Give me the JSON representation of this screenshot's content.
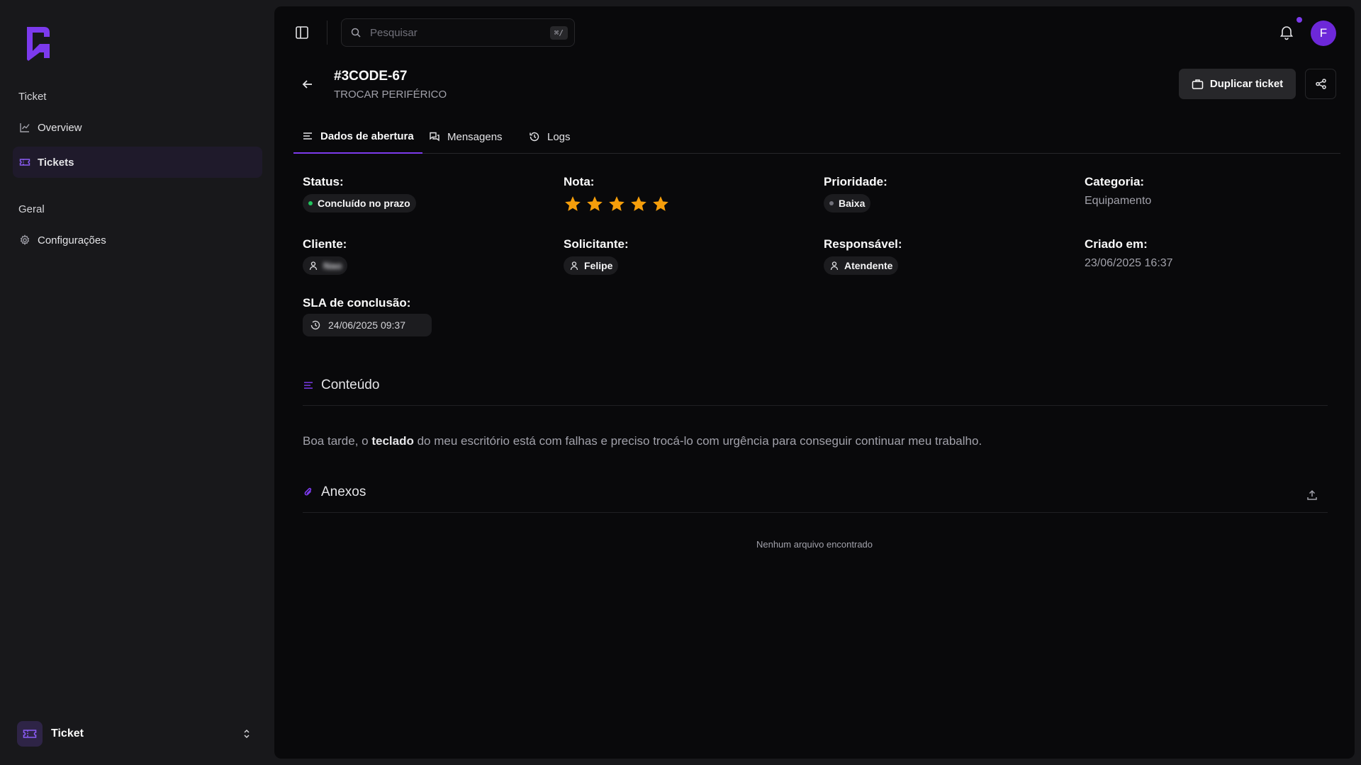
{
  "sidebar": {
    "sections": [
      {
        "label": "Ticket",
        "items": [
          {
            "label": "Overview",
            "icon": "chart-line-icon"
          },
          {
            "label": "Tickets",
            "icon": "ticket-icon",
            "active": true
          }
        ]
      },
      {
        "label": "Geral",
        "items": [
          {
            "label": "Configurações",
            "icon": "gear-icon"
          }
        ]
      }
    ],
    "footer": {
      "app_name": "Ticket"
    }
  },
  "topbar": {
    "search_placeholder": "Pesquisar",
    "search_shortcut": "⌘/",
    "avatar_initial": "F"
  },
  "ticket": {
    "id": "#3CODE-67",
    "subtitle": "TROCAR PERIFÉRICO",
    "duplicate_label": "Duplicar ticket"
  },
  "tabs": [
    {
      "label": "Dados de abertura",
      "active": true
    },
    {
      "label": "Mensagens"
    },
    {
      "label": "Logs"
    }
  ],
  "fields": {
    "status": {
      "label": "Status:",
      "value": "Concluído no prazo",
      "color": "#22c55e"
    },
    "nota": {
      "label": "Nota:",
      "rating": 5,
      "max": 5,
      "color": "#f59e0b"
    },
    "prioridade": {
      "label": "Prioridade:",
      "value": "Baixa",
      "color": "#71717a"
    },
    "categoria": {
      "label": "Categoria:",
      "value": "Equipamento"
    },
    "cliente": {
      "label": "Cliente:",
      "value": "Nao"
    },
    "solicitante": {
      "label": "Solicitante:",
      "value": "Felipe"
    },
    "responsavel": {
      "label": "Responsável:",
      "value": "Atendente"
    },
    "criado": {
      "label": "Criado em:",
      "value": "23/06/2025 16:37"
    },
    "sla": {
      "label": "SLA de conclusão:",
      "value": "24/06/2025 09:37"
    }
  },
  "conteudo": {
    "title": "Conteúdo",
    "text_before": "Boa tarde, o ",
    "text_bold": "teclado",
    "text_after": " do meu escritório está com falhas e preciso trocá-lo com urgência para conseguir continuar meu trabalho."
  },
  "anexos": {
    "title": "Anexos",
    "empty_message": "Nenhum arquivo encontrado"
  },
  "colors": {
    "accent": "#7c3aed",
    "background": "#09090b",
    "sidebar": "#18181b"
  }
}
